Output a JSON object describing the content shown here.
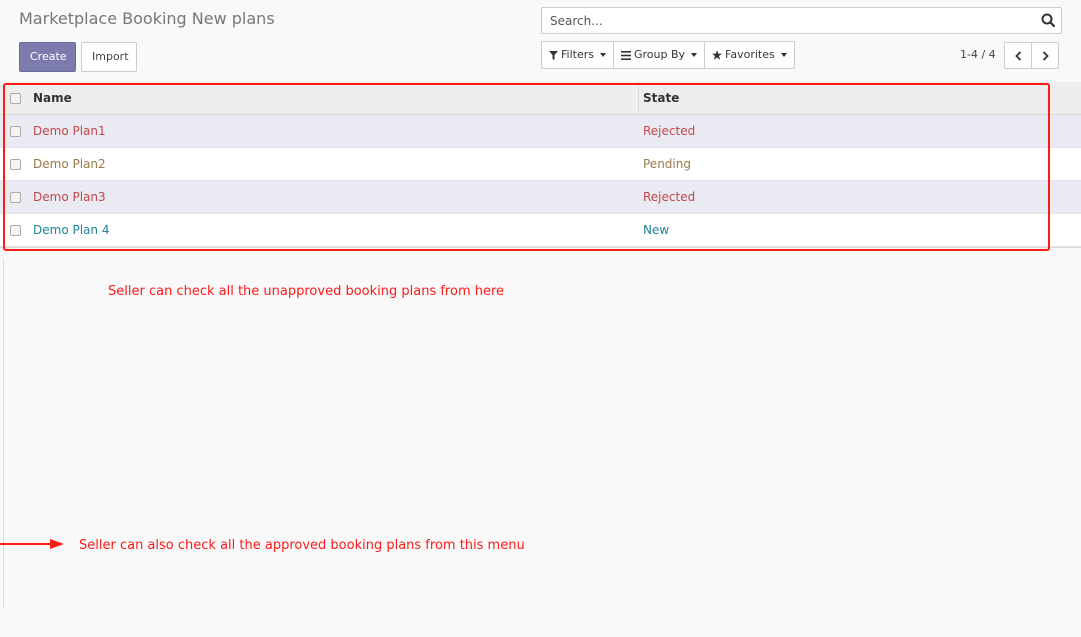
{
  "header": {
    "title": "Marketplace Booking New plans",
    "create_label": "Create",
    "import_label": "Import"
  },
  "search": {
    "placeholder": "Search...",
    "value": ""
  },
  "filters": {
    "filters_label": "Filters",
    "group_by_label": "Group By",
    "favorites_label": "Favorites"
  },
  "pager": {
    "value": "1-4 / 4"
  },
  "table": {
    "columns": [
      "Name",
      "State"
    ],
    "rows": [
      {
        "name": "Demo Plan1",
        "state": "Rejected"
      },
      {
        "name": "Demo Plan2",
        "state": "Pending"
      },
      {
        "name": "Demo Plan3",
        "state": "Rejected"
      },
      {
        "name": "Demo Plan 4",
        "state": "New"
      }
    ]
  },
  "annotations": {
    "top": "Seller can check all the unapproved booking plans from here",
    "bottom": "Seller can also check all the approved booking plans from this menu"
  },
  "colors": {
    "rejected": "#c0474b",
    "pending": "#9a7a48",
    "new": "#21829b",
    "annotation": "#ff1a1a",
    "primary": "#7c7bad"
  }
}
